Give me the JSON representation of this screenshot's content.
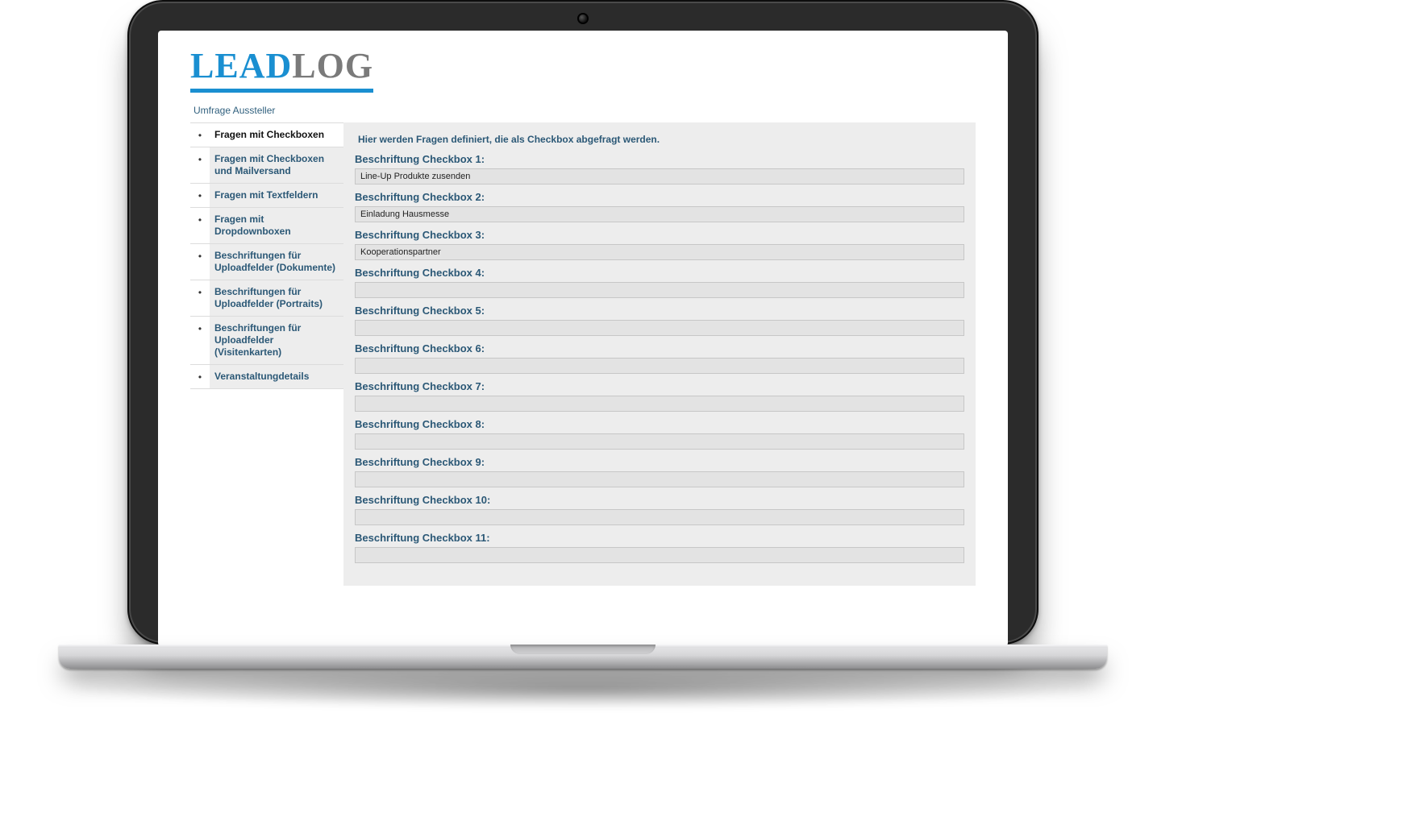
{
  "logo": {
    "part1": "LEAD",
    "part2": "LOG"
  },
  "subtitle": "Umfrage Aussteller",
  "sidebar": {
    "items": [
      {
        "label": "Fragen mit Checkboxen",
        "active": true
      },
      {
        "label": "Fragen mit Checkboxen und Mailversand",
        "active": false
      },
      {
        "label": "Fragen mit Textfeldern",
        "active": false
      },
      {
        "label": "Fragen mit Dropdownboxen",
        "active": false
      },
      {
        "label": "Beschriftungen für Uploadfelder (Dokumente)",
        "active": false
      },
      {
        "label": "Beschriftungen für Uploadfelder (Portraits)",
        "active": false
      },
      {
        "label": "Beschriftungen für Uploadfelder (Visitenkarten)",
        "active": false
      },
      {
        "label": "Veranstaltungdetails",
        "active": false
      }
    ]
  },
  "main": {
    "intro": "Hier werden Fragen definiert, die als Checkbox abgefragt werden.",
    "fields": [
      {
        "label": "Beschriftung Checkbox 1:",
        "value": "Line-Up Produkte zusenden"
      },
      {
        "label": "Beschriftung Checkbox 2:",
        "value": "Einladung Hausmesse"
      },
      {
        "label": "Beschriftung Checkbox 3:",
        "value": "Kooperationspartner"
      },
      {
        "label": "Beschriftung Checkbox 4:",
        "value": ""
      },
      {
        "label": "Beschriftung Checkbox 5:",
        "value": ""
      },
      {
        "label": "Beschriftung Checkbox 6:",
        "value": ""
      },
      {
        "label": "Beschriftung Checkbox 7:",
        "value": ""
      },
      {
        "label": "Beschriftung Checkbox 8:",
        "value": ""
      },
      {
        "label": "Beschriftung Checkbox 9:",
        "value": ""
      },
      {
        "label": "Beschriftung Checkbox 10:",
        "value": ""
      },
      {
        "label": "Beschriftung Checkbox 11:",
        "value": ""
      }
    ]
  }
}
